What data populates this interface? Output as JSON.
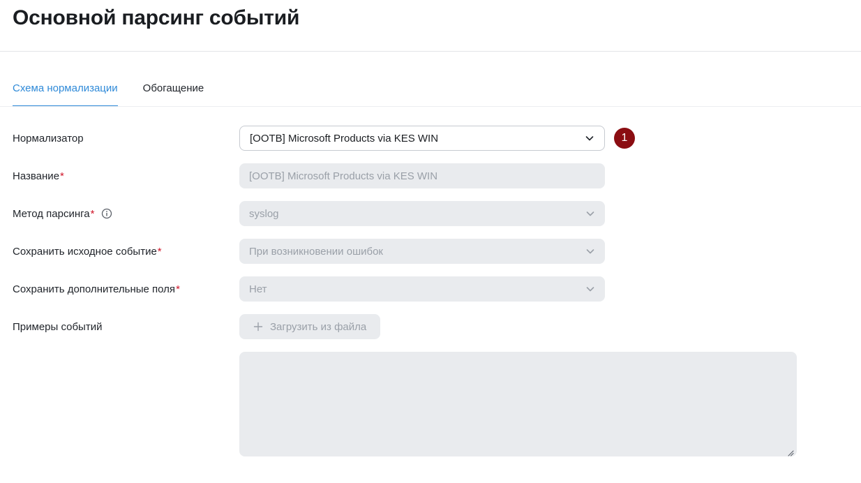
{
  "page": {
    "title": "Основной парсинг событий"
  },
  "tabs": [
    {
      "label": "Схема нормализации",
      "active": true
    },
    {
      "label": "Обогащение",
      "active": false
    }
  ],
  "form": {
    "normalizer": {
      "label": "Нормализатор",
      "value": "[OOTB] Microsoft Products via KES WIN",
      "badge": "1"
    },
    "name": {
      "label": "Название",
      "required_mark": "*",
      "value": "[OOTB] Microsoft Products via KES WIN"
    },
    "parse_method": {
      "label": "Метод парсинга",
      "required_mark": "*",
      "value": "syslog",
      "icon": "info-icon"
    },
    "save_original": {
      "label": "Сохранить исходное событие",
      "required_mark": "*",
      "value": "При возникновении ошибок"
    },
    "save_extra": {
      "label": "Сохранить дополнительные поля",
      "required_mark": "*",
      "value": "Нет"
    },
    "samples": {
      "label": "Примеры событий",
      "upload_label": "Загрузить из файла"
    }
  },
  "colors": {
    "accent": "#2f8ad8",
    "required": "#d0162a",
    "badge": "#8b0d12",
    "disabled_bg": "#e9ebee"
  }
}
